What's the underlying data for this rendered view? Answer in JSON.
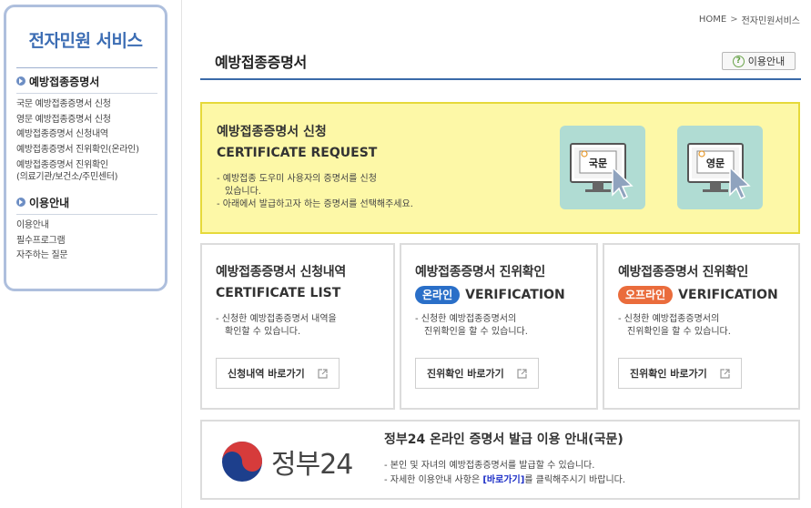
{
  "sidebar": {
    "title": "전자민원 서비스",
    "section1": {
      "heading": "예방접종증명서",
      "items": [
        "국문 예방접종증명서 신청",
        "영문 예방접종증명서 신청",
        "예방접종증명서 신청내역",
        "예방접종증명서 진위확인(온라인)",
        "예방접종증명서 진위확인",
        "(의료기관/보건소/주민센터)"
      ]
    },
    "section2": {
      "heading": "이용안내",
      "items": [
        "이용안내",
        "필수프로그램",
        "자주하는 질문"
      ]
    }
  },
  "breadcrumb": {
    "home": "HOME",
    "sep": ">",
    "current": "전자민원서비스"
  },
  "page": {
    "title": "예방접종증명서",
    "help_label": "이용안내",
    "help_icon": "?"
  },
  "request": {
    "title": "예방접종증명서 신청",
    "subtitle": "CERTIFICATE REQUEST",
    "desc1a": "- 예방접종 도우미 사용자의 증명서를 신청",
    "desc1b": "있습니다.",
    "desc2": "- 아래에서 발급하고자 하는 증명서를 선택해주세요.",
    "korean_label": "국문",
    "english_label": "영문"
  },
  "cards": {
    "list": {
      "title": "예방접종증명서 신청내역",
      "subtitle": "CERTIFICATE LIST",
      "desc1": "- 신청한 예방접종증명서 내역을",
      "desc2": "확인할 수 있습니다.",
      "button": "신청내역 바로가기"
    },
    "online": {
      "title": "예방접종증명서 진위확인",
      "badge": "온라인",
      "subtitle": "VERIFICATION",
      "desc1": "- 신청한 예방접종증명서의",
      "desc2": "진위확인을 할 수 있습니다.",
      "button": "진위확인 바로가기"
    },
    "offline": {
      "title": "예방접종증명서 진위확인",
      "badge": "오프라인",
      "subtitle": "VERIFICATION",
      "desc1": "- 신청한 예방접종증명서의",
      "desc2": "진위확인을 할 수 있습니다.",
      "button": "진위확인 바로가기"
    }
  },
  "info": {
    "logo_text": "정부24",
    "title": "정부24 온라인 증명서 발급 이용 안내(국문)",
    "desc1": "- 본인 및 자녀의 예방접종증명서를 발급할 수 있습니다.",
    "desc2_pre": "- 자세한 이용안내 사항은 ",
    "desc2_link": "[바로가기]",
    "desc2_post": "를 클릭해주시기 바랍니다."
  },
  "colors": {
    "accent_blue": "#3c6db4",
    "request_bg": "#fdf8a7",
    "cert_button_bg": "#b0dcd3",
    "online_badge": "#2a6fc8",
    "offline_badge": "#ea6c3c"
  }
}
